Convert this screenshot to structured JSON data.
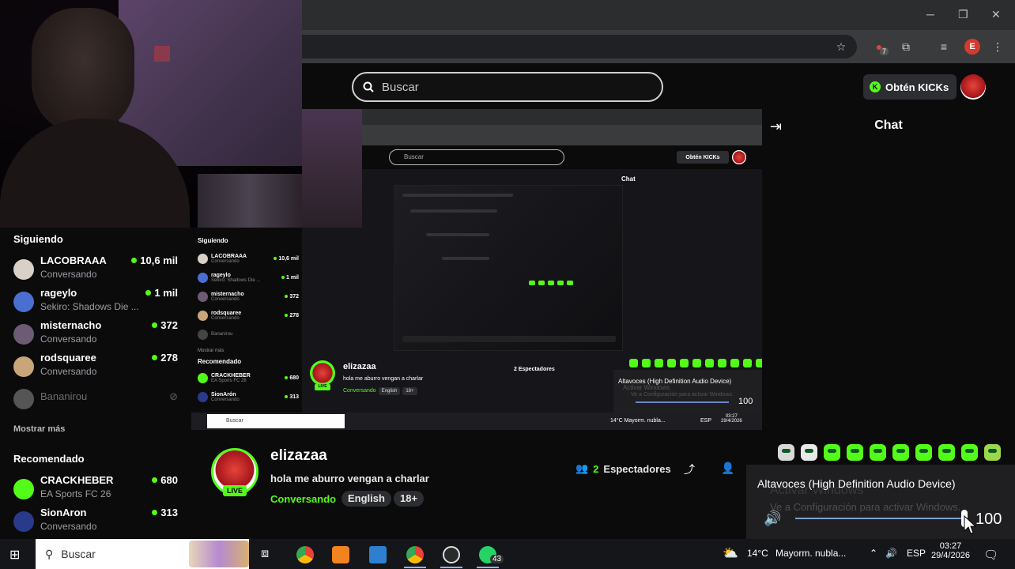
{
  "kick": {
    "search_placeholder": "Buscar",
    "kicks_button": "Obtén KICKs",
    "chat_title": "Chat"
  },
  "sidebar": {
    "following_heading": "Siguiendo",
    "following": [
      {
        "name": "LACOBRAAA",
        "subtitle": "Conversando",
        "viewers": "10,6 mil",
        "avatar_color": "#d9d0c8"
      },
      {
        "name": "rageylo",
        "subtitle": "Sekiro: Shadows Die ...",
        "viewers": "1 mil",
        "avatar_color": "#4a6fd1"
      },
      {
        "name": "misternacho",
        "subtitle": "Conversando",
        "viewers": "372",
        "avatar_color": "#6d5b74"
      },
      {
        "name": "rodsquaree",
        "subtitle": "Conversando",
        "viewers": "278",
        "avatar_color": "#c9a67a"
      }
    ],
    "offline": [
      {
        "name": "Bananirou"
      }
    ],
    "show_more": "Mostrar más",
    "recommended_heading": "Recomendado",
    "recommended": [
      {
        "name": "CRACKHEBER",
        "subtitle": "EA Sports FC 26",
        "viewers": "680",
        "avatar_color": "#53fc18"
      },
      {
        "name": "SionAron",
        "subtitle": "Conversando",
        "viewers": "313",
        "avatar_color": "#2a3a8a"
      }
    ]
  },
  "stream": {
    "streamer": "elizazaa",
    "title": "hola me aburro vengan a charlar",
    "category": "Conversando",
    "tags": [
      "English",
      "18+"
    ],
    "live": "LIVE",
    "viewers_count": "2",
    "viewers_label": "Espectadores"
  },
  "volume": {
    "device": "Altavoces (High Definition Audio Device)",
    "watermark_title": "Activar Windows",
    "watermark_sub": "Ve a Configuración para activar Windows.",
    "value": "100"
  },
  "nested": {
    "search": "Buscar",
    "kicks": "Obtén KICKs",
    "chat": "Chat",
    "following_heading": "Siguiendo",
    "items": [
      {
        "name": "LACOBRAAA",
        "sub": "Conversando",
        "count": "10,6 mil"
      },
      {
        "name": "rageylo",
        "sub": "Sekiro: Shadows Die ...",
        "count": "1 mil"
      },
      {
        "name": "misternacho",
        "sub": "Conversando",
        "count": "372"
      },
      {
        "name": "rodsquaree",
        "sub": "Conversando",
        "count": "278"
      }
    ],
    "offline": "Bananirou",
    "show_more": "Mostrar más",
    "recommended": "Recomendado",
    "rec_items": [
      {
        "name": "CRACKHEBER",
        "sub": "EA Sports FC 26",
        "count": "680"
      },
      {
        "name": "SionArón",
        "sub": "Conversando",
        "count": "313"
      }
    ],
    "streamer": "elizazaa",
    "title": "hola me aburro vengan a charlar",
    "category": "Conversando",
    "tags": [
      "English",
      "18+"
    ],
    "viewers": "2 Espectadores",
    "vol_device": "Altavoces (High Definition Audio Device)",
    "vol_watermark": "Activar Windows",
    "vol_watermark_sub": "Ve a Configuración para activar Windows.",
    "vol_value": "100",
    "taskbar_search": "Buscar",
    "taskbar_weather": "14°C  Mayorm. nubla...",
    "taskbar_lang": "ESP",
    "taskbar_time": "03:27",
    "taskbar_date": "29/4/2026"
  },
  "taskbar": {
    "search_placeholder": "Buscar",
    "weather": "14°C",
    "weather_text": "Mayorm. nubla...",
    "language": "ESP",
    "time": "03:27",
    "date": "29/4/2026",
    "whatsapp_badge": "43"
  },
  "browser": {
    "extension_badge": "7",
    "profile_initial": "E"
  }
}
